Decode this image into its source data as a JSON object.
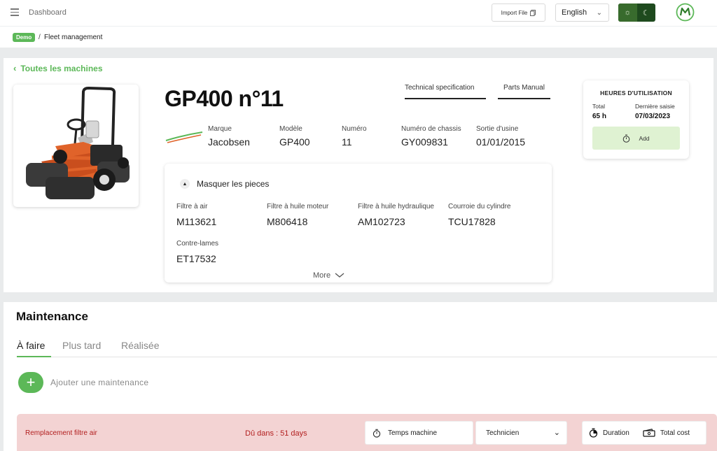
{
  "topbar": {
    "title": "Dashboard",
    "import_label": "Import File",
    "language": "English",
    "theme_light_icon": "sun-icon",
    "theme_dark_icon": "moon-icon"
  },
  "breadcrumb": {
    "badge": "Demo",
    "separator": "/",
    "page": "Fleet management"
  },
  "machine": {
    "back_label": "Toutes les machines",
    "title": "GP400 n°11",
    "tabs": [
      "Technical specification",
      "Parts Manual"
    ],
    "specs": [
      {
        "label": "Marque",
        "value": "Jacobsen"
      },
      {
        "label": "Modèle",
        "value": "GP400"
      },
      {
        "label": "Numéro",
        "value": "11"
      },
      {
        "label": "Numéro de chassis",
        "value": "GY009831"
      },
      {
        "label": "Sortie d'usine",
        "value": "01/01/2015"
      }
    ],
    "parts_toggle": "Masquer les pieces",
    "parts": [
      {
        "label": "Filtre à air",
        "value": "M113621"
      },
      {
        "label": "Filtre à huile moteur",
        "value": "M806418"
      },
      {
        "label": "Filtre à huile hydraulique",
        "value": "AM102723"
      },
      {
        "label": "Courroie du cylindre",
        "value": "TCU17828"
      },
      {
        "label": "Contre-lames",
        "value": "ET17532"
      }
    ],
    "more_label": "More",
    "hours": {
      "title": "HEURES D'UTILISATION",
      "total_label": "Total",
      "total_value": "65 h",
      "last_label": "Dernière saisie",
      "last_value": "07/03/2023",
      "add_label": "Add"
    }
  },
  "maintenance": {
    "title": "Maintenance",
    "tabs": [
      "À faire",
      "Plus tard",
      "Réalisée"
    ],
    "add_label": "Ajouter une maintenance",
    "row": {
      "name": "Remplacement filtre air",
      "due": "Dû dans : 51 days",
      "machine_time_label": "Temps machine",
      "technician_label": "Technicien",
      "duration_label": "Duration",
      "total_cost_label": "Total cost"
    }
  },
  "colors": {
    "accent": "#5cb858",
    "overdue_bg": "#f3d3d3",
    "overdue_text": "#b21f1f",
    "theme_dark": "#1e4a1e"
  }
}
